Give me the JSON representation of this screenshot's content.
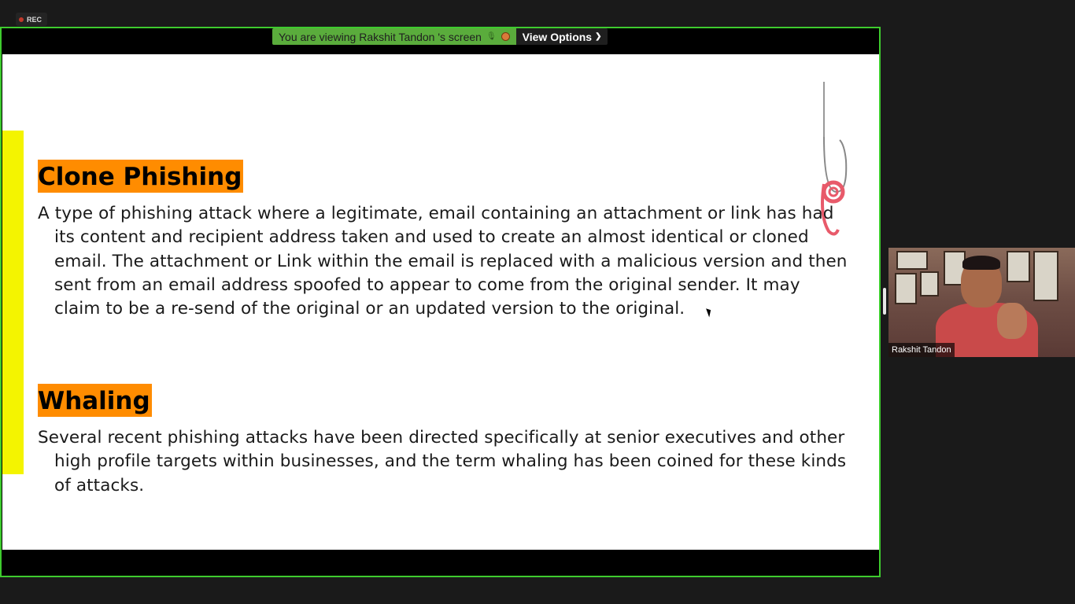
{
  "recording": {
    "label": "REC"
  },
  "banner": {
    "viewing_text": "You are viewing Rakshit Tandon 's screen",
    "view_options_label": "View Options"
  },
  "slide": {
    "heading_1": "Clone Phishing",
    "paragraph_1": "A type of phishing attack where a legitimate, email containing an attachment or link has had its content and recipient address taken and used to create an almost identical or cloned email. The attachment or Link within the email is replaced with a malicious version and then sent from an email address spoofed to appear to come from the original sender. It may claim to be a re-send of the original or an updated version to the original.",
    "heading_2": "Whaling",
    "paragraph_2": "Several recent phishing attacks have been directed specifically at senior executives and other high profile targets within businesses, and the term whaling has been coined for these kinds of attacks."
  },
  "participant": {
    "name": "Rakshit Tandon"
  },
  "colors": {
    "share_border": "#3ecb2e",
    "banner_green": "#5aac3c",
    "heading_bg": "#ff8c00",
    "accent_bar": "#f4f400"
  },
  "icons": [
    "mic-icon",
    "stop-share-icon",
    "chevron-down-icon",
    "phishing-hook-icon",
    "cursor-icon"
  ]
}
